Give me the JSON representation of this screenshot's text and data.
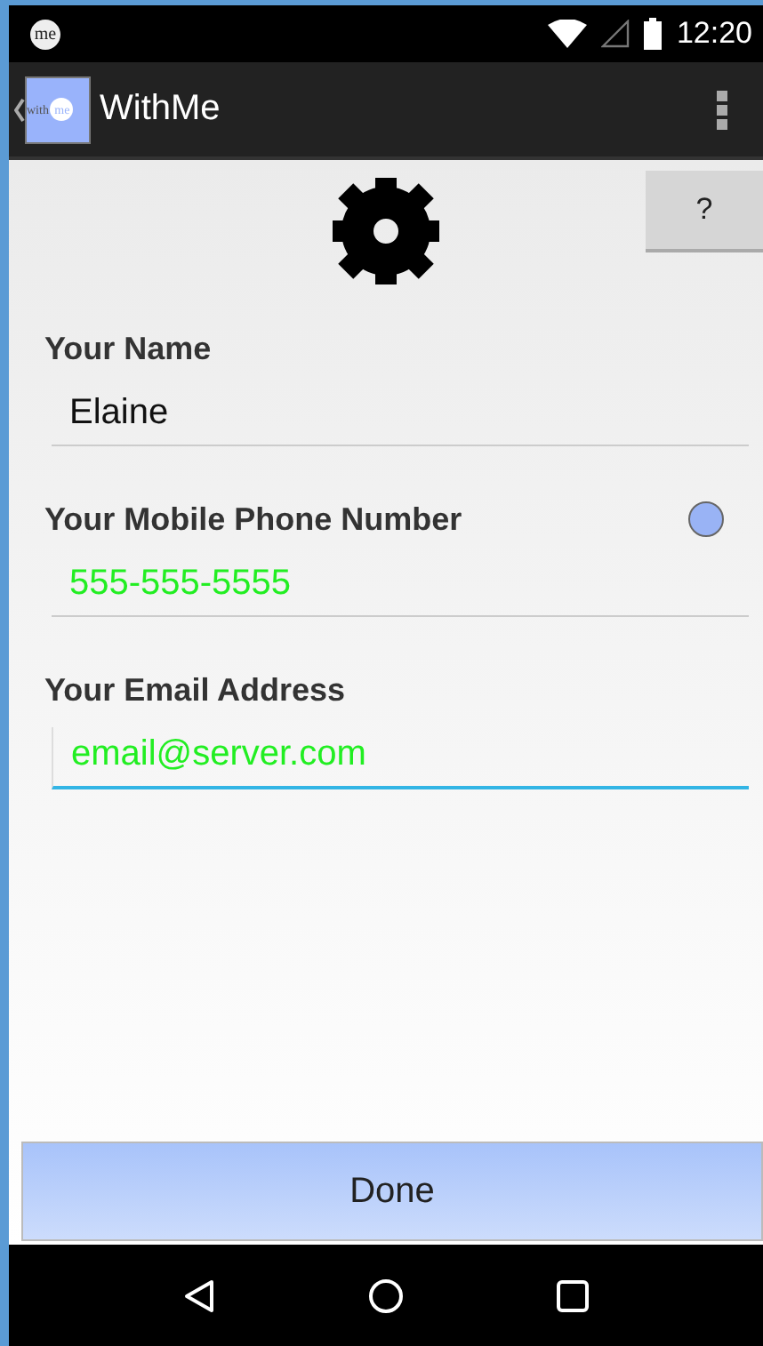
{
  "status_bar": {
    "app_badge": "me",
    "time": "12:20"
  },
  "action_bar": {
    "logo_left": "with",
    "logo_right": "me",
    "title": "WithMe"
  },
  "help_button": {
    "label": "?"
  },
  "fields": [
    {
      "label": "Your Name",
      "value": "Elaine",
      "focused": false,
      "color": "#111111"
    },
    {
      "label": "Your Mobile Phone Number",
      "value": "555-555-5555",
      "focused": false,
      "color": "#22ee22",
      "indicator": {
        "color": "#99b3f5"
      }
    },
    {
      "label": "Your Email Address",
      "value": "email@server.com",
      "focused": true,
      "color": "#22ee22"
    }
  ],
  "done_button": {
    "label": "Done"
  }
}
